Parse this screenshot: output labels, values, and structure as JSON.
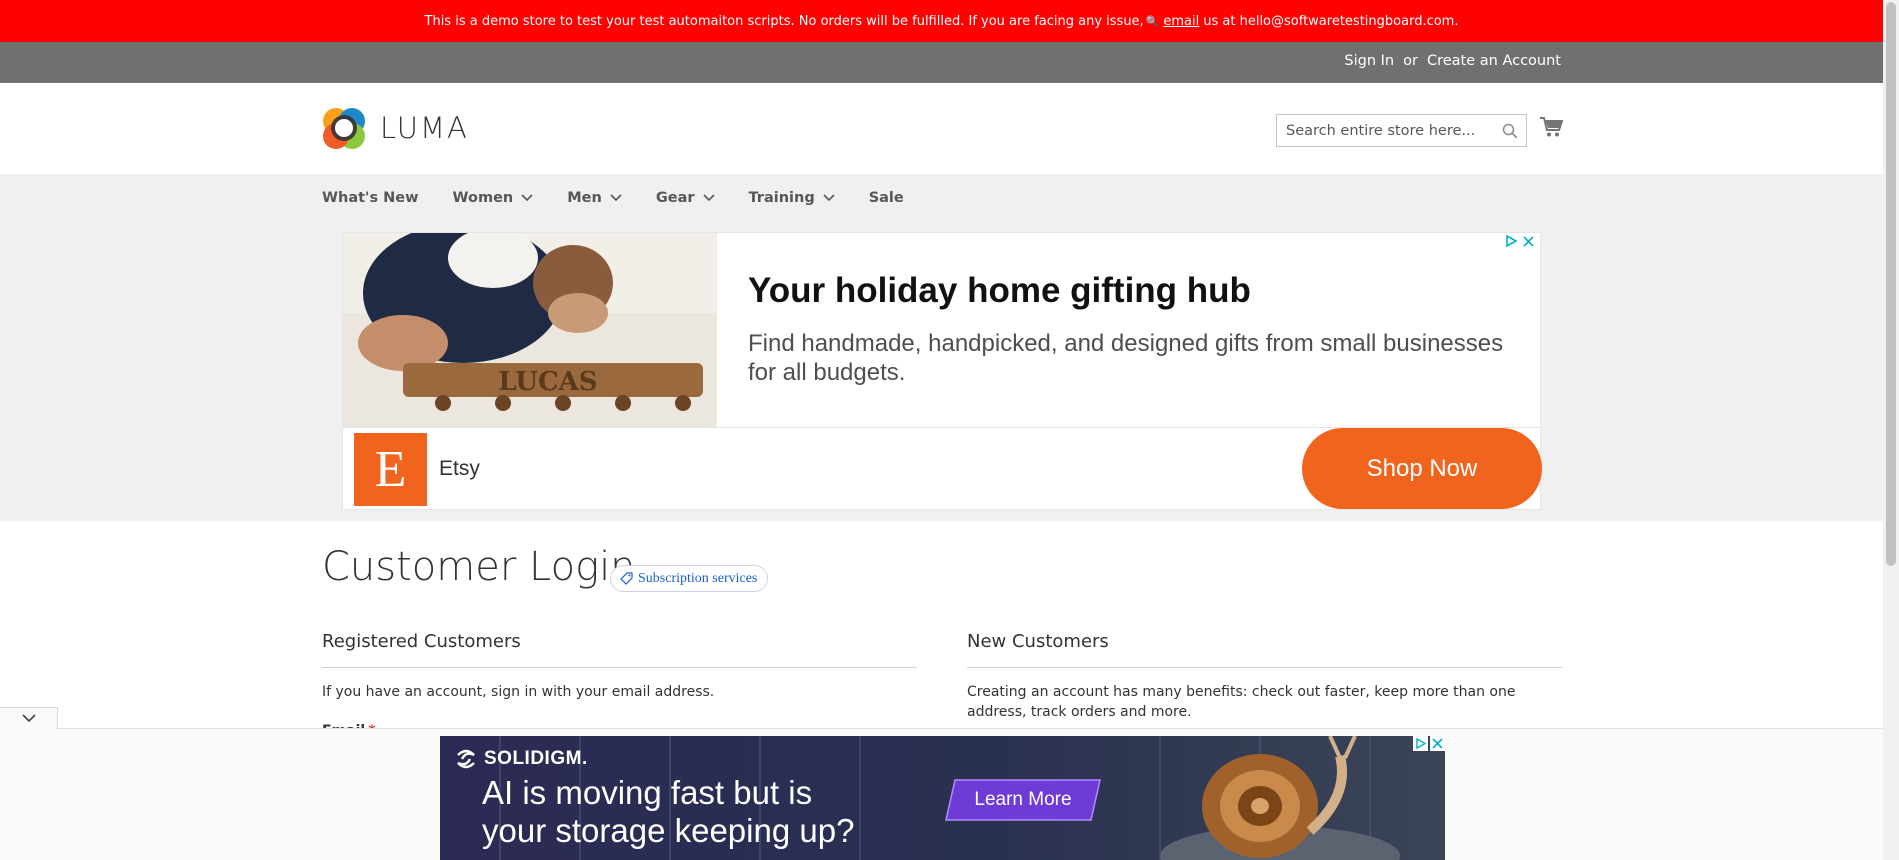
{
  "notice": {
    "text": "This is a demo store to test your test automaiton scripts. No orders will be fulfilled. If you are facing any issue,",
    "key_icon": "🔍",
    "email_link": "email",
    "text_after": "us at hello@softwaretestingboard.com."
  },
  "account": {
    "sign_in": "Sign In",
    "or": "or",
    "create_account": "Create an Account"
  },
  "header": {
    "logo_text": "LUMA",
    "search_placeholder": "Search entire store here...",
    "icons": {
      "search": "search-icon",
      "cart": "cart-icon"
    }
  },
  "nav": {
    "items": [
      {
        "label": "What's New",
        "has_dropdown": false
      },
      {
        "label": "Women",
        "has_dropdown": true
      },
      {
        "label": "Men",
        "has_dropdown": true
      },
      {
        "label": "Gear",
        "has_dropdown": true
      },
      {
        "label": "Training",
        "has_dropdown": true
      },
      {
        "label": "Sale",
        "has_dropdown": false
      }
    ]
  },
  "banner_ad": {
    "title": "Your holiday home gifting hub",
    "description": "Find handmade, handpicked, and designed gifts from small businesses for all budgets.",
    "photo_text": "LUCAS",
    "logo_letter": "E",
    "brand": "Etsy",
    "cta": "Shop Now"
  },
  "main": {
    "title": "Customer Login",
    "badge": "Subscription services",
    "registered": {
      "title": "Registered Customers",
      "text": "If you have an account, sign in with your email address.",
      "email_label": "Email",
      "required_mark": "*"
    },
    "new_customers": {
      "title": "New Customers",
      "text": "Creating an account has many benefits: check out faster, keep more than one address, track orders and more."
    }
  },
  "bottom_ad": {
    "brand": "SOLIDIGM.",
    "headline_line1": "AI is moving fast but is",
    "headline_line2": "your storage keeping up?",
    "cta": "Learn More"
  },
  "colors": {
    "notice_bg": "#ff0101",
    "account_bar_bg": "#6e716e",
    "nav_bg": "#f0f0f0",
    "etsy_orange": "#f1641e",
    "link_blue": "#1a5fc9"
  }
}
